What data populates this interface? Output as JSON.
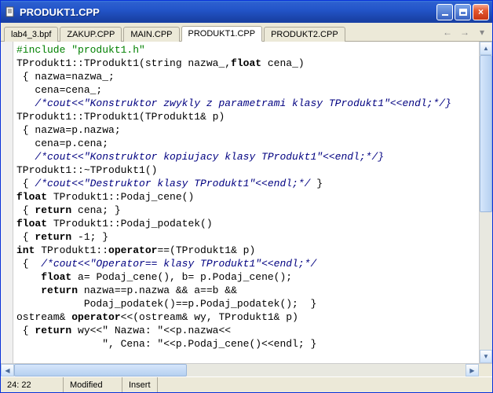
{
  "window": {
    "title": "PRODUKT1.CPP"
  },
  "tabs": [
    {
      "label": "lab4_3.bpf"
    },
    {
      "label": "ZAKUP.CPP"
    },
    {
      "label": "MAIN.CPP"
    },
    {
      "label": "PRODUKT1.CPP"
    },
    {
      "label": "PRODUKT2.CPP"
    }
  ],
  "nav": {
    "back": "←",
    "fwd": "→",
    "down": "▾"
  },
  "code": {
    "l1a": "#include ",
    "l1b": "\"produkt1.h\"",
    "l2": "",
    "l3a": "TProdukt1::TProdukt1(string nazwa_,",
    "l3b": "float",
    "l3c": " cena_)",
    "l4": " { nazwa=nazwa_;",
    "l5": "   cena=cena_;",
    "l6": "   /*cout<<\"Konstruktor zwykly z parametrami klasy TProdukt1\"<<endl;*/}",
    "l7": "TProdukt1::TProdukt1(TProdukt1& p)",
    "l8": " { nazwa=p.nazwa;",
    "l9": "   cena=p.cena;",
    "l10": "   /*cout<<\"Konstruktor kopiujacy klasy TProdukt1\"<<endl;*/}",
    "l11": "TProdukt1::~TProdukt1()",
    "l12a": " { ",
    "l12b": "/*cout<<\"Destruktor klasy TProdukt1\"<<endl;*/",
    "l12c": " }",
    "l13a": "float",
    "l13b": " TProdukt1::Podaj_cene()",
    "l14a": " { ",
    "l14b": "return",
    "l14c": " cena; }",
    "l15a": "float",
    "l15b": " TProdukt1::Podaj_podatek()",
    "l16a": " { ",
    "l16b": "return",
    "l16c": " -1; }",
    "l17a": "int",
    "l17b": " TProdukt1::",
    "l17c": "operator",
    "l17d": "==(TProdukt1& p)",
    "l18a": " {  ",
    "l18b": "/*cout<<\"Operator== klasy TProdukt1\"<<endl;*/",
    "l19a": "    ",
    "l19b": "float",
    "l19c": " a= Podaj_cene(), b= p.Podaj_cene();",
    "l20a": "    ",
    "l20b": "return",
    "l20c": " nazwa==p.nazwa && a==b &&",
    "l21": "           Podaj_podatek()==p.Podaj_podatek();  }",
    "l22a": "ostream& ",
    "l22b": "operator",
    "l22c": "<<(ostream& wy, TProdukt1& p)",
    "l23a": " { ",
    "l23b": "return",
    "l23c": " wy<<\" Nazwa: \"<<p.nazwa<<",
    "l24": "              \", Cena: \"<<p.Podaj_cene()<<endl; }"
  },
  "status": {
    "pos": "24: 22",
    "modified": "Modified",
    "mode": "Insert"
  },
  "scroll": {
    "up": "▲",
    "down": "▼",
    "left": "◀",
    "right": "▶"
  }
}
